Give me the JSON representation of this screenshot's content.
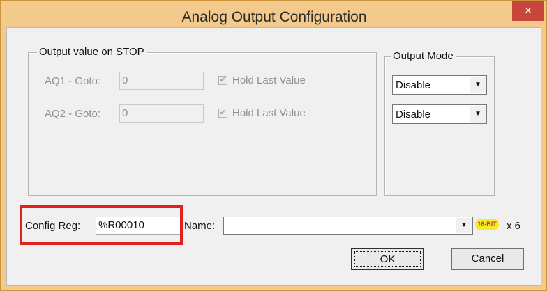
{
  "window": {
    "title": "Analog Output Configuration",
    "close_label": "×"
  },
  "stop_group": {
    "label": "Output value on STOP",
    "rows": [
      {
        "label": "AQ1 - Goto:",
        "value": "0",
        "hold_label": "Hold Last Value",
        "hold_checked_glyph": "✔"
      },
      {
        "label": "AQ2 - Goto:",
        "value": "0",
        "hold_label": "Hold Last Value",
        "hold_checked_glyph": "✔"
      }
    ]
  },
  "mode_group": {
    "label": "Output Mode",
    "selects": [
      {
        "value": "Disable"
      },
      {
        "value": "Disable"
      }
    ],
    "arrow_glyph": "▼"
  },
  "bottom": {
    "config_reg_label": "Config Reg:",
    "config_reg_value": "%R00010",
    "name_label": "Name:",
    "name_value": "",
    "badge_text": "16-BIT",
    "multiplier": "x 6"
  },
  "buttons": {
    "ok": "OK",
    "cancel": "Cancel"
  },
  "colors": {
    "frame": "#f3c98c",
    "close": "#c7453a",
    "highlight": "#e2201c",
    "badge": "#f2ec2a"
  }
}
